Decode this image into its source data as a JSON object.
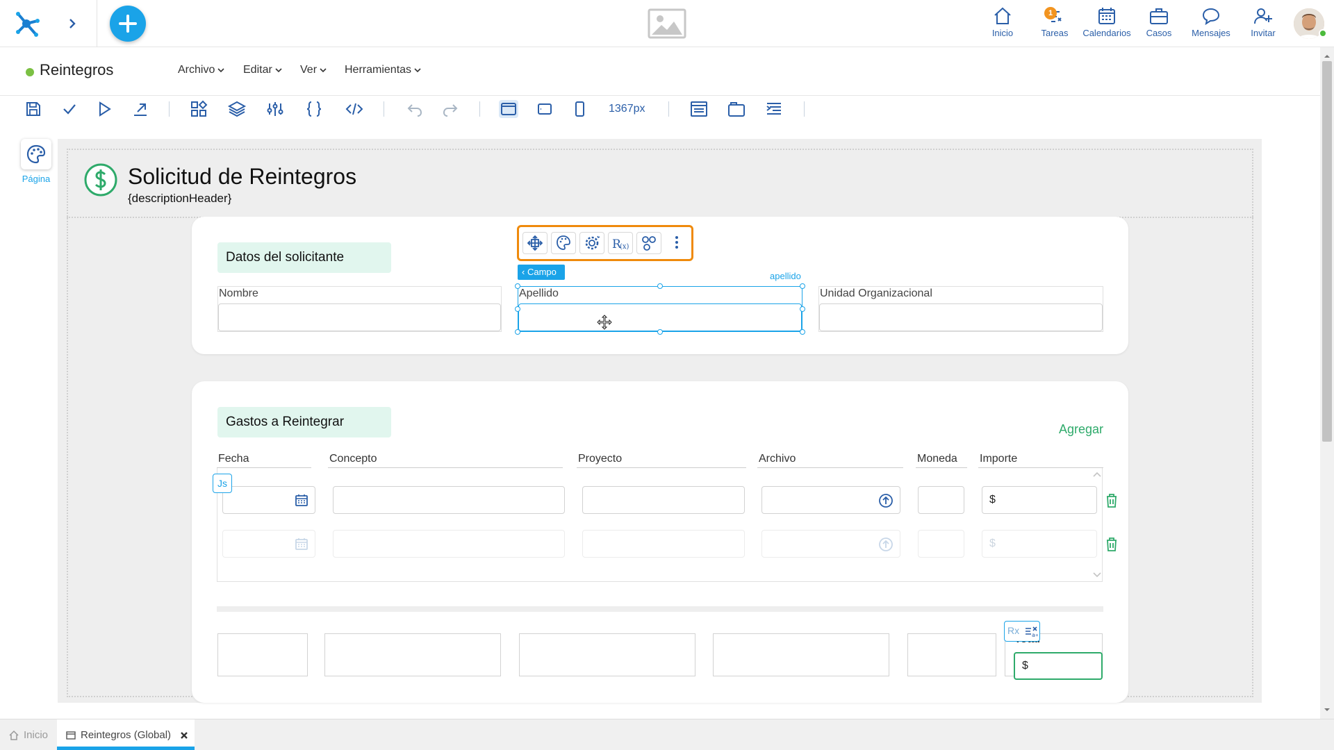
{
  "topbar": {
    "nav": [
      {
        "label": "Inicio",
        "icon": "home-icon"
      },
      {
        "label": "Tareas",
        "icon": "tasks-icon",
        "badge": "1"
      },
      {
        "label": "Calendarios",
        "icon": "calendar-icon"
      },
      {
        "label": "Casos",
        "icon": "briefcase-icon"
      },
      {
        "label": "Mensajes",
        "icon": "chat-icon"
      },
      {
        "label": "Invitar",
        "icon": "invite-user-icon"
      }
    ]
  },
  "menubar": {
    "app_title": "Reintegros",
    "menus": [
      "Archivo",
      "Editar",
      "Ver",
      "Herramientas"
    ]
  },
  "toolbar": {
    "width_label": "1367px"
  },
  "sidebar": {
    "page_label": "Página"
  },
  "form": {
    "title": "Solicitud de Reintegros",
    "description": "{descriptionHeader}",
    "section1": {
      "title": "Datos del solicitante",
      "fields": [
        "Nombre",
        "Apellido",
        "Unidad Organizacional"
      ]
    },
    "selection": {
      "campo_tag": "Campo",
      "field_id": "apellido"
    },
    "section2": {
      "title": "Gastos a Reintegrar",
      "add_label": "Agregar",
      "columns": [
        "Fecha",
        "Concepto",
        "Proyecto",
        "Archivo",
        "Moneda",
        "Importe"
      ],
      "currency_symbol": "$",
      "js_tag": "Js"
    },
    "totals": {
      "label": "Total",
      "currency_symbol": "$",
      "rx_tag": "Rx"
    }
  },
  "bottom_tabs": [
    {
      "label": "Inicio",
      "active": false
    },
    {
      "label": "Reintegros (Global)",
      "active": true
    }
  ],
  "colors": {
    "primary": "#1aa3e8",
    "nav_text": "#2a5ea8",
    "accent_green": "#2eaa6a",
    "selection_orange": "#ef8a0c",
    "section_bg": "#e1f6ee"
  }
}
